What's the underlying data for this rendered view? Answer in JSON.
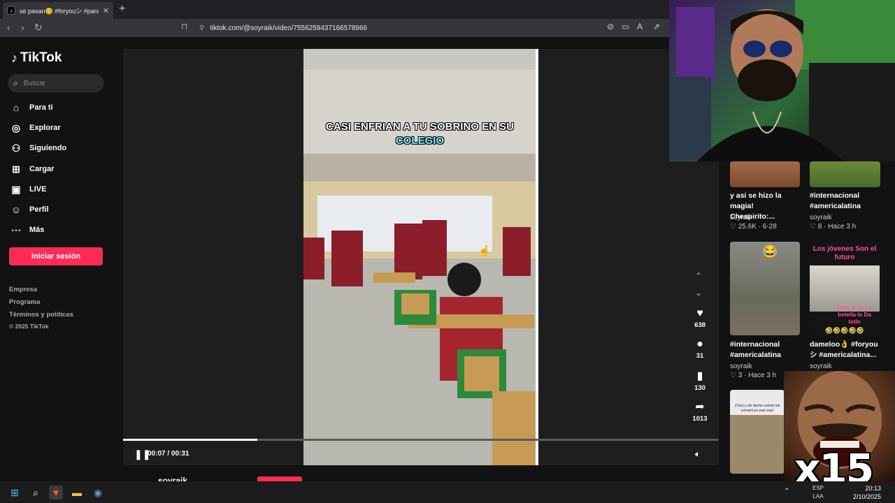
{
  "browser": {
    "tab_title": "se pasan🥴 #foryouシ #parati",
    "url": "tiktok.com/@soyraik/video/7556259437166578966"
  },
  "sidebar": {
    "logo": "TikTok",
    "search_placeholder": "Buscar",
    "nav": [
      {
        "label": "Para ti",
        "icon": "home-icon"
      },
      {
        "label": "Explorar",
        "icon": "compass-icon"
      },
      {
        "label": "Siguiendo",
        "icon": "following-icon"
      },
      {
        "label": "Cargar",
        "icon": "upload-icon"
      },
      {
        "label": "LIVE",
        "icon": "live-icon"
      },
      {
        "label": "Perfil",
        "icon": "profile-icon"
      },
      {
        "label": "Más",
        "icon": "more-icon"
      }
    ],
    "login_label": "Iniciar sesión",
    "footer": [
      "Empresa",
      "Programa",
      "Términos y políticas",
      "© 2025 TikTok"
    ]
  },
  "player": {
    "caption_line1": "CASI ENFRIAN A TU SOBRINO EN  SU",
    "caption_line2": "COLEGIO",
    "time": "00:07 / 00:31",
    "progress": 0.2258,
    "author": "soyraik"
  },
  "actions": {
    "likes": "638",
    "comments": "31",
    "saves": "130",
    "shares": "1013"
  },
  "cards": [
    {
      "title": "y asi se hizo la magia! Chespirito:...",
      "user": "soyraik",
      "likes": "25.6K",
      "date": "6-28"
    },
    {
      "title": "#internacional #americalatina",
      "user": "soyraik",
      "likes": "8",
      "date": "Hace 3 h"
    },
    {
      "title": "#internacional #americalatina",
      "user": "soyraik",
      "likes": "3",
      "date": "Hace 3 h"
    },
    {
      "title": "dameloo👌 #foryou シ #americalatina...",
      "user": "soyraik"
    }
  ],
  "thumb_texts": {
    "card4_top": "Los jóvenes Son el futuro",
    "card4_mid": "Pero el de La botella lo Da todo",
    "card5_top": "¡Creci y sin darme cuenta me converti en este wey!"
  },
  "overlay": {
    "meme_text": "x15"
  },
  "taskbar": {
    "lang": "ESP",
    "lang2": "LAA",
    "time": "20:13",
    "date": "2/10/2025"
  },
  "colors": {
    "brand": "#fe2c55",
    "background": "#121212"
  }
}
